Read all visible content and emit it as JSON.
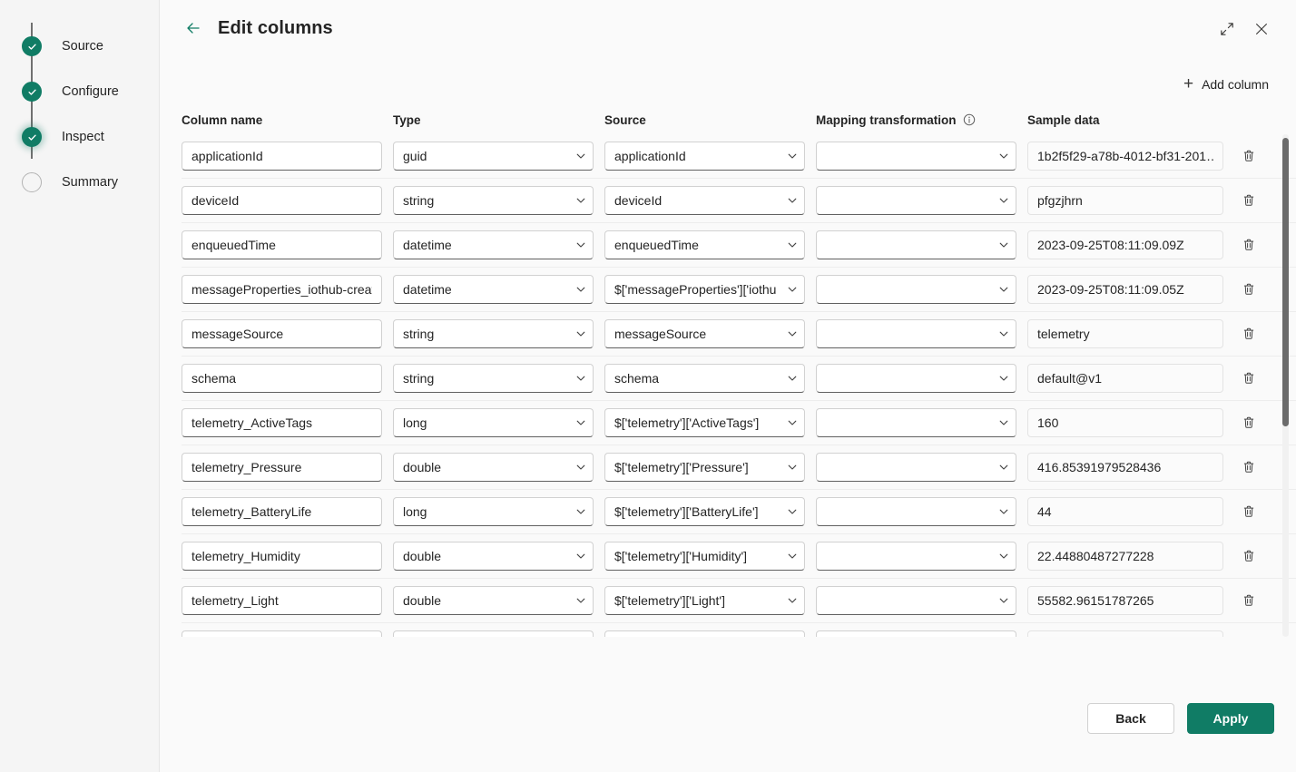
{
  "colors": {
    "accent": "#107c65",
    "text": "#242424",
    "sidebar_bg": "#f5f5f5",
    "main_bg": "#fafafa",
    "field_border": "#d1d1d1",
    "field_underline": "#616161"
  },
  "wizard": {
    "steps": [
      {
        "label": "Source",
        "state": "done"
      },
      {
        "label": "Configure",
        "state": "done"
      },
      {
        "label": "Inspect",
        "state": "current"
      },
      {
        "label": "Summary",
        "state": "pending"
      }
    ]
  },
  "header": {
    "title": "Edit columns",
    "back_icon": "arrow-left-icon",
    "expand_icon": "expand-diagonal-icon",
    "close_icon": "close-icon"
  },
  "toolbar": {
    "add_column_label": "Add column",
    "add_column_icon": "plus-icon"
  },
  "table": {
    "headers": {
      "column_name": "Column name",
      "type": "Type",
      "source": "Source",
      "mapping_transformation": "Mapping transformation",
      "mapping_info_icon": "info-icon",
      "sample_data": "Sample data"
    },
    "delete_icon": "trash-icon",
    "dropdown_icon": "chevron-down-icon",
    "rows": [
      {
        "column_name": "applicationId",
        "type": "guid",
        "source": "applicationId",
        "mapping_transformation": "",
        "sample_data": "1b2f5f29-a78b-4012-bf31-201…"
      },
      {
        "column_name": "deviceId",
        "type": "string",
        "source": "deviceId",
        "mapping_transformation": "",
        "sample_data": "pfgzjhrn"
      },
      {
        "column_name": "enqueuedTime",
        "type": "datetime",
        "source": "enqueuedTime",
        "mapping_transformation": "",
        "sample_data": "2023-09-25T08:11:09.09Z"
      },
      {
        "column_name": "messageProperties_iothub-creat",
        "type": "datetime",
        "source": "$['messageProperties']['iothu",
        "mapping_transformation": "",
        "sample_data": "2023-09-25T08:11:09.05Z"
      },
      {
        "column_name": "messageSource",
        "type": "string",
        "source": "messageSource",
        "mapping_transformation": "",
        "sample_data": "telemetry"
      },
      {
        "column_name": "schema",
        "type": "string",
        "source": "schema",
        "mapping_transformation": "",
        "sample_data": "default@v1"
      },
      {
        "column_name": "telemetry_ActiveTags",
        "type": "long",
        "source": "$['telemetry']['ActiveTags']",
        "mapping_transformation": "",
        "sample_data": "160"
      },
      {
        "column_name": "telemetry_Pressure",
        "type": "double",
        "source": "$['telemetry']['Pressure']",
        "mapping_transformation": "",
        "sample_data": "416.85391979528436"
      },
      {
        "column_name": "telemetry_BatteryLife",
        "type": "long",
        "source": "$['telemetry']['BatteryLife']",
        "mapping_transformation": "",
        "sample_data": "44"
      },
      {
        "column_name": "telemetry_Humidity",
        "type": "double",
        "source": "$['telemetry']['Humidity']",
        "mapping_transformation": "",
        "sample_data": "22.44880487277228"
      },
      {
        "column_name": "telemetry_Light",
        "type": "double",
        "source": "$['telemetry']['Light']",
        "mapping_transformation": "",
        "sample_data": "55582.96151787265"
      },
      {
        "column_name": "",
        "type": "",
        "source": "",
        "mapping_transformation": "",
        "sample_data": ""
      }
    ]
  },
  "footer": {
    "back_label": "Back",
    "apply_label": "Apply"
  }
}
